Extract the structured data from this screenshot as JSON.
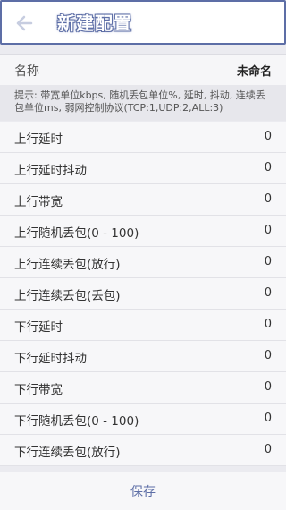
{
  "header": {
    "title": "新建配置",
    "back_icon": "back-arrow-icon",
    "accent_color": "#5d6ea6"
  },
  "name_field": {
    "label": "名称",
    "value": "未命名"
  },
  "hint": "提示: 带宽单位kbps, 随机丢包单位%, 延时, 抖动, 连续丢包单位ms, 弱网控制协议(TCP:1,UDP:2,ALL:3)",
  "params": [
    {
      "label": "上行延时",
      "value": "0"
    },
    {
      "label": "上行延时抖动",
      "value": "0"
    },
    {
      "label": "上行带宽",
      "value": "0"
    },
    {
      "label": "上行随机丢包(0 - 100)",
      "value": "0"
    },
    {
      "label": "上行连续丢包(放行)",
      "value": "0"
    },
    {
      "label": "上行连续丢包(丢包)",
      "value": "0"
    },
    {
      "label": "下行延时",
      "value": "0"
    },
    {
      "label": "下行延时抖动",
      "value": "0"
    },
    {
      "label": "下行带宽",
      "value": "0"
    },
    {
      "label": "下行随机丢包(0 - 100)",
      "value": "0"
    },
    {
      "label": "下行连续丢包(放行)",
      "value": "0"
    }
  ],
  "footer": {
    "save_label": "保存"
  }
}
